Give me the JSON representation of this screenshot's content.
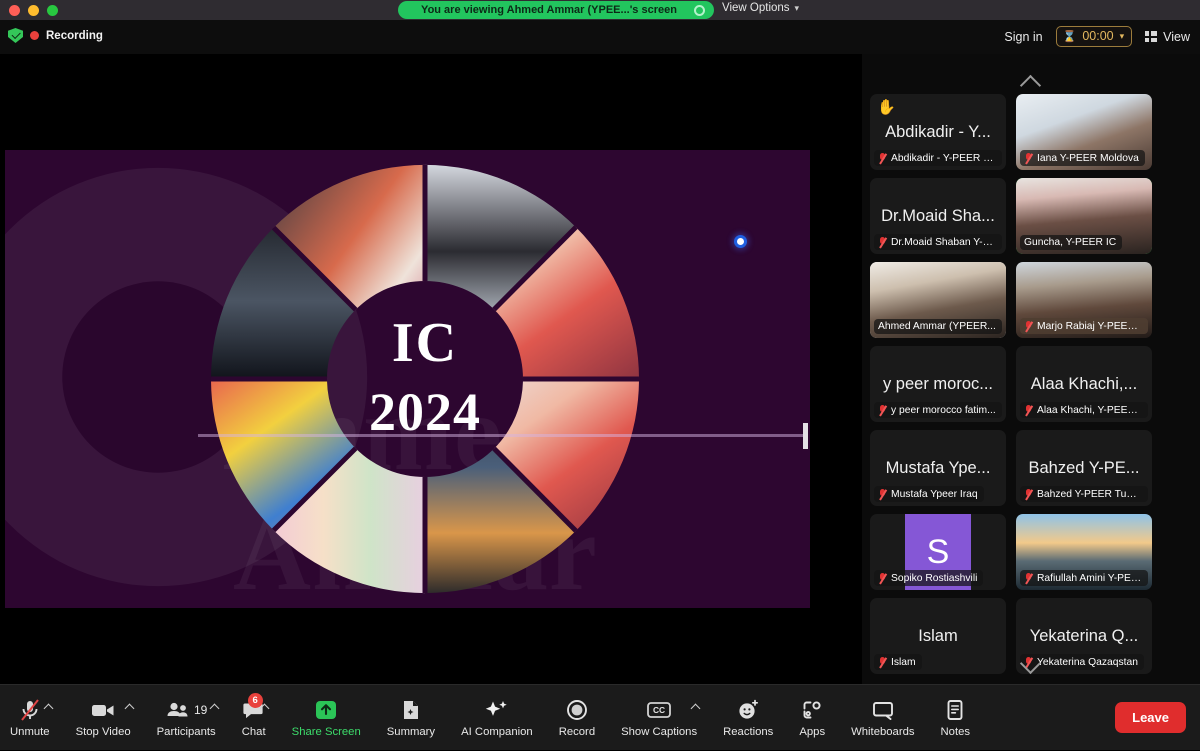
{
  "window": {
    "traffic_lights": [
      "close",
      "minimize",
      "maximize"
    ]
  },
  "share_banner": {
    "text": "You are viewing Ahmed Ammar (YPEE...'s screen",
    "view_options_label": "View Options"
  },
  "topbar": {
    "recording_label": "Recording",
    "sign_in_label": "Sign in",
    "timer_value": "00:00",
    "view_label": "View"
  },
  "shared_screen": {
    "center_line_1": "IC",
    "center_line_2": "2024",
    "watermark_1": "Ahmed",
    "watermark_2": "Ammar",
    "background_color": "#2d0630"
  },
  "filmstrip": {
    "scroll_up": "scroll-up",
    "scroll_down": "scroll-down",
    "tiles": [
      {
        "display_name": "Abdikadir - Y...",
        "label": "Abdikadir - Y-PEER S...",
        "muted": true,
        "has_video": false,
        "raised_hand": true,
        "border": "none",
        "label_style": "solid"
      },
      {
        "display_name": "",
        "label": "Iana Y-PEER Moldova",
        "muted": true,
        "has_video": true,
        "raised_hand": false,
        "border": "none",
        "label_style": "solid"
      },
      {
        "display_name": "Dr.Moaid Sha...",
        "label": "Dr.Moaid Shaban Y-P...",
        "muted": true,
        "has_video": false,
        "raised_hand": false,
        "border": "none",
        "label_style": "solid"
      },
      {
        "display_name": "",
        "label": "Guncha, Y-PEER IC",
        "muted": false,
        "has_video": true,
        "raised_hand": false,
        "border": "green",
        "label_style": "solid"
      },
      {
        "display_name": "",
        "label": "Ahmed Ammar (YPEER...",
        "muted": false,
        "has_video": true,
        "raised_hand": false,
        "border": "white",
        "label_style": "solid"
      },
      {
        "display_name": "",
        "label": "Marjo Rabiaj Y-PEER...",
        "muted": true,
        "has_video": true,
        "raised_hand": false,
        "border": "none",
        "label_style": "brown"
      },
      {
        "display_name": "y peer moroc...",
        "label": "y peer morocco fatim...",
        "muted": true,
        "has_video": false,
        "raised_hand": false,
        "border": "none",
        "label_style": "solid"
      },
      {
        "display_name": "Alaa Khachi,...",
        "label": "Alaa Khachi, Y-PEER...",
        "muted": true,
        "has_video": false,
        "raised_hand": false,
        "border": "none",
        "label_style": "solid"
      },
      {
        "display_name": "Mustafa Ype...",
        "label": "Mustafa Ypeer Iraq",
        "muted": true,
        "has_video": false,
        "raised_hand": false,
        "border": "none",
        "label_style": "solid"
      },
      {
        "display_name": "Bahzed Y-PE...",
        "label": "Bahzed Y-PEER Tunisia",
        "muted": true,
        "has_video": false,
        "raised_hand": false,
        "border": "none",
        "label_style": "solid"
      },
      {
        "display_name": "",
        "label": "Sopiko Rostiashvili",
        "muted": true,
        "has_video": false,
        "raised_hand": false,
        "border": "none",
        "label_style": "solid",
        "avatar_letter": "S",
        "avatar_color": "#8557d6"
      },
      {
        "display_name": "",
        "label": "Rafiullah Amini Y-PEE...",
        "muted": true,
        "has_video": true,
        "raised_hand": false,
        "border": "none",
        "label_style": "solid"
      },
      {
        "display_name": "Islam",
        "label": "Islam",
        "muted": true,
        "has_video": false,
        "raised_hand": false,
        "border": "none",
        "label_style": "solid"
      },
      {
        "display_name": "Yekaterina Q...",
        "label": "Yekaterina Qazaqstan",
        "muted": true,
        "has_video": false,
        "raised_hand": false,
        "border": "none",
        "label_style": "solid"
      }
    ]
  },
  "toolbar": {
    "items": [
      {
        "label": "Unmute",
        "icon": "microphone-muted-icon",
        "caret": true
      },
      {
        "label": "Stop Video",
        "icon": "video-camera-icon",
        "caret": true
      },
      {
        "label": "Participants",
        "icon": "participants-icon",
        "caret": true,
        "count": "19"
      },
      {
        "label": "Chat",
        "icon": "chat-bubble-icon",
        "caret": true,
        "badge": "6"
      },
      {
        "label": "Share Screen",
        "icon": "share-screen-icon",
        "highlight": true
      },
      {
        "label": "Summary",
        "icon": "summary-document-icon"
      },
      {
        "label": "AI Companion",
        "icon": "ai-sparkle-icon"
      },
      {
        "label": "Record",
        "icon": "record-circle-icon"
      },
      {
        "label": "Show Captions",
        "icon": "closed-captions-icon",
        "caret": true
      },
      {
        "label": "Reactions",
        "icon": "reactions-smiley-icon"
      },
      {
        "label": "Apps",
        "icon": "apps-icon"
      },
      {
        "label": "Whiteboards",
        "icon": "whiteboard-icon"
      },
      {
        "label": "Notes",
        "icon": "notes-icon"
      }
    ],
    "leave_label": "Leave",
    "accent_green": "#3ddc6b",
    "leave_red": "#e02d2d"
  }
}
